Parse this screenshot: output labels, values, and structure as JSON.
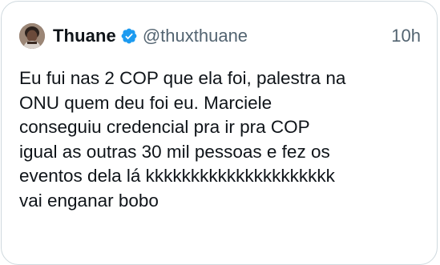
{
  "tweet": {
    "author": {
      "display_name": "Thuane",
      "handle": "@thuxthuane",
      "verified": true,
      "verified_color": "#1d9bf0"
    },
    "time": "10h",
    "text_lines": [
      "Eu fui nas 2 COP que ela foi, palestra na",
      "ONU quem deu foi eu. Marciele",
      "conseguiu credencial pra ir pra COP",
      "igual as outras 30 mil pessoas e fez os",
      "eventos dela lá kkkkkkkkkkkkkkkkkkkkk",
      "vai enganar bobo"
    ]
  }
}
